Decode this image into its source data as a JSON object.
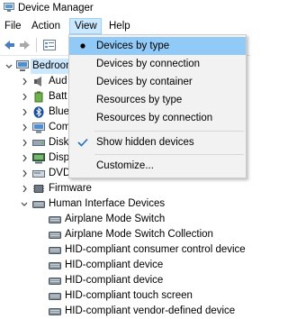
{
  "window": {
    "title": "Device Manager"
  },
  "menubar": {
    "items": [
      "File",
      "Action",
      "View",
      "Help"
    ]
  },
  "view_menu": {
    "items": [
      {
        "label": "Devices by type",
        "mark": "radio-dot"
      },
      {
        "label": "Devices by connection"
      },
      {
        "label": "Devices by container"
      },
      {
        "label": "Resources by type"
      },
      {
        "label": "Resources by connection"
      },
      {
        "label": "Show hidden devices",
        "mark": "checkmark"
      },
      {
        "label": "Customize..."
      }
    ]
  },
  "tree": {
    "root": "Bedroom",
    "categories": [
      {
        "label": "Aud",
        "icon": "speaker-icon"
      },
      {
        "label": "Batt",
        "icon": "battery-icon"
      },
      {
        "label": "Blue",
        "icon": "bluetooth-icon"
      },
      {
        "label": "Com",
        "icon": "computer-icon"
      },
      {
        "label": "Disk",
        "icon": "disk-drive-icon"
      },
      {
        "label": "Disp",
        "icon": "display-adapter-icon"
      },
      {
        "label": "DVD",
        "icon": "dvd-drive-icon"
      },
      {
        "label": "Firmware",
        "icon": "firmware-icon"
      },
      {
        "label": "Human Interface Devices",
        "icon": "hid-icon",
        "expanded": true
      }
    ],
    "hid_children": [
      "Airplane Mode Switch",
      "Airplane Mode Switch Collection",
      "HID-compliant consumer control device",
      "HID-compliant device",
      "HID-compliant device",
      "HID-compliant touch screen",
      "HID-compliant vendor-defined device"
    ]
  },
  "colors": {
    "menu_highlight": "#91c9f7",
    "menu_open": "#cce8ff",
    "check_color": "#1f6fbf"
  }
}
